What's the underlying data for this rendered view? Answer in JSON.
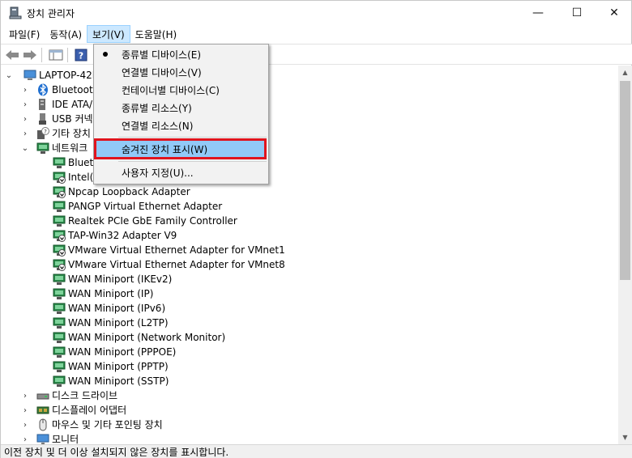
{
  "window": {
    "title": "장치 관리자",
    "controls": [
      "—",
      "☐",
      "✕"
    ]
  },
  "menubar": {
    "items": [
      "파일(F)",
      "동작(A)",
      "보기(V)",
      "도움말(H)"
    ]
  },
  "view_menu": {
    "items": [
      {
        "label": "종류별 디바이스(E)",
        "checked": true
      },
      {
        "label": "연결별 디바이스(V)"
      },
      {
        "label": "컨테이너별 디바이스(C)"
      },
      {
        "label": "종류별 리소스(Y)"
      },
      {
        "label": "연결별 리소스(N)"
      },
      {
        "label": "숨겨진 장치 표시(W)",
        "highlighted": true
      },
      {
        "label": "사용자 지정(U)..."
      }
    ]
  },
  "tree": {
    "root": "LAPTOP-42M",
    "categories_top": [
      {
        "label": "Bluetooth",
        "icon": "bluetooth-icon"
      },
      {
        "label": "IDE ATA/",
        "icon": "ide-controller-icon"
      },
      {
        "label": "USB 커넥",
        "icon": "usb-icon"
      },
      {
        "label": "기타 장치",
        "icon": "unknown-device-icon"
      },
      {
        "label": "네트워크",
        "icon": "network-adapter-icon",
        "expanded": true
      }
    ],
    "network_adapters": [
      {
        "label": "Blueto",
        "disabled": false
      },
      {
        "label": "Intel(R",
        "disabled": true
      },
      {
        "label": "Npcap Loopback Adapter",
        "disabled": true
      },
      {
        "label": "PANGP Virtual Ethernet Adapter",
        "disabled": false
      },
      {
        "label": "Realtek PCIe GbE Family Controller",
        "disabled": false
      },
      {
        "label": "TAP-Win32 Adapter V9",
        "disabled": true
      },
      {
        "label": "VMware Virtual Ethernet Adapter for VMnet1",
        "disabled": true
      },
      {
        "label": "VMware Virtual Ethernet Adapter for VMnet8",
        "disabled": true
      },
      {
        "label": "WAN Miniport (IKEv2)",
        "disabled": false
      },
      {
        "label": "WAN Miniport (IP)",
        "disabled": false
      },
      {
        "label": "WAN Miniport (IPv6)",
        "disabled": false
      },
      {
        "label": "WAN Miniport (L2TP)",
        "disabled": false
      },
      {
        "label": "WAN Miniport (Network Monitor)",
        "disabled": false
      },
      {
        "label": "WAN Miniport (PPPOE)",
        "disabled": false
      },
      {
        "label": "WAN Miniport (PPTP)",
        "disabled": false
      },
      {
        "label": "WAN Miniport (SSTP)",
        "disabled": false
      }
    ],
    "categories_bottom": [
      {
        "label": "디스크 드라이브",
        "icon": "disk-drive-icon"
      },
      {
        "label": "디스플레이 어댑터",
        "icon": "display-adapter-icon"
      },
      {
        "label": "마우스 및 기타 포인팅 장치",
        "icon": "mouse-icon"
      },
      {
        "label": "모니터",
        "icon": "monitor-icon"
      }
    ]
  },
  "statusbar": {
    "text": "이전 장치 및 더 이상 설치되지 않은 장치를 표시합니다."
  },
  "colors": {
    "menu_active_bg": "#cce8ff",
    "menu_highlight_bg": "#91c9f7",
    "annotation_red": "#e0141e"
  }
}
